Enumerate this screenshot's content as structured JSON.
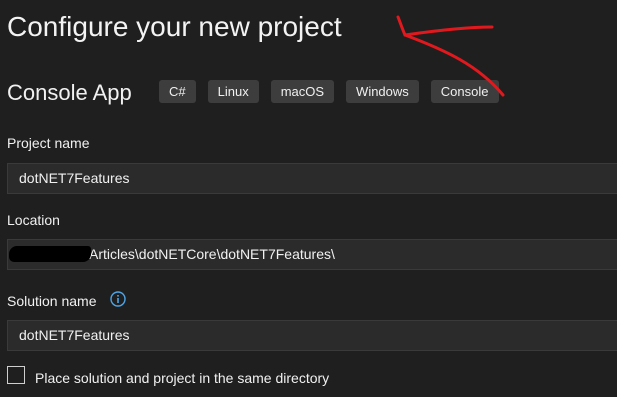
{
  "header": {
    "title": "Configure your new project"
  },
  "template": {
    "name": "Console App",
    "tags": [
      "C#",
      "Linux",
      "macOS",
      "Windows",
      "Console"
    ]
  },
  "project_name": {
    "label": "Project name",
    "value": "dotNET7Features"
  },
  "location": {
    "label": "Location",
    "value": "Articles\\dotNETCore\\dotNET7Features\\"
  },
  "solution_name": {
    "label": "Solution name",
    "value": "dotNET7Features"
  },
  "same_directory": {
    "label": "Place solution and project in the same directory",
    "checked": false
  },
  "colors": {
    "background": "#1f1f1f",
    "tag_background": "#3d3d3d",
    "input_background": "#2b2b2b",
    "info_icon": "#4ea6e8",
    "annotation_arrow": "#e0191e"
  },
  "icons": {
    "info": "info-icon",
    "arrow": "arrow-annotation"
  }
}
